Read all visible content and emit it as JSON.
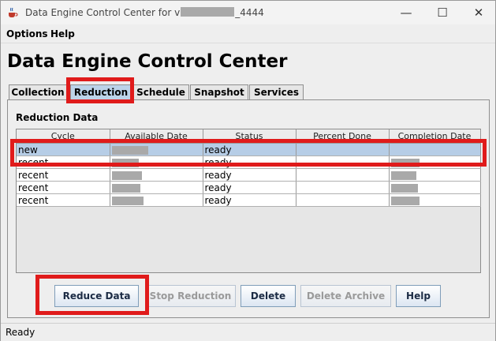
{
  "window": {
    "title_prefix": "Data Engine Control Center for v",
    "title_suffix": "_4444",
    "controls": {
      "minimize": "—",
      "maximize": "☐",
      "close": "✕"
    }
  },
  "menu": {
    "options": "Options",
    "help": "Help"
  },
  "heading": "Data Engine Control Center",
  "tabs": [
    {
      "label": "Collection",
      "active": false
    },
    {
      "label": "Reduction",
      "active": true
    },
    {
      "label": "Schedule",
      "active": false
    },
    {
      "label": "Snapshot",
      "active": false
    },
    {
      "label": "Services",
      "active": false
    }
  ],
  "panel": {
    "section_label": "Reduction Data",
    "columns": [
      "Cycle",
      "Available Date",
      "Status",
      "Percent Done",
      "Completion Date"
    ],
    "rows": [
      {
        "cycle": "new",
        "status": "ready",
        "selected": true
      },
      {
        "cycle": "recent",
        "status": "ready",
        "selected": false
      },
      {
        "cycle": "recent",
        "status": "ready",
        "selected": false
      },
      {
        "cycle": "recent",
        "status": "ready",
        "selected": false
      },
      {
        "cycle": "recent",
        "status": "ready",
        "selected": false
      }
    ]
  },
  "buttons": {
    "reduce": "Reduce Data",
    "stop": "Stop Reduction",
    "delete": "Delete",
    "delete_archive": "Delete Archive",
    "help": "Help"
  },
  "status": "Ready",
  "colors": {
    "highlight": "#e01b1b",
    "selection": "#b6cde6",
    "active_tab": "#bcd3e9"
  }
}
